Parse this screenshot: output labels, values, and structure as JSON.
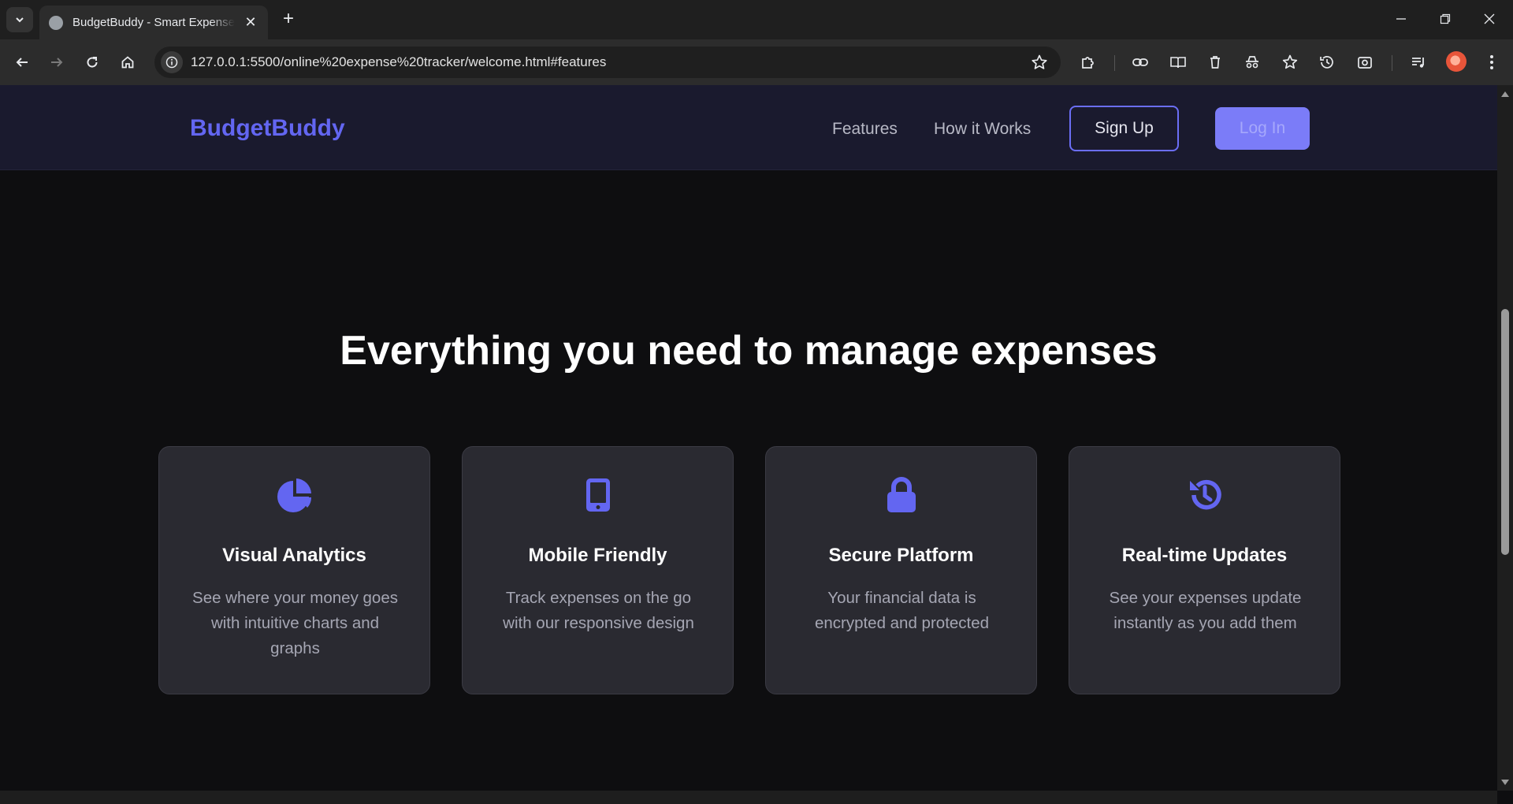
{
  "browser": {
    "tab_title": "BudgetBuddy - Smart Expense Tracker",
    "url": "127.0.0.1:5500/online%20expense%20tracker/welcome.html#features"
  },
  "site": {
    "brand": "BudgetBuddy",
    "nav": {
      "features": "Features",
      "how_it_works": "How it Works",
      "sign_up": "Sign Up",
      "log_in": "Log In"
    }
  },
  "features": {
    "title": "Everything you need to manage expenses",
    "cards": [
      {
        "icon": "pie-chart-icon",
        "title": "Visual Analytics",
        "description": "See where your money goes with intuitive charts and graphs"
      },
      {
        "icon": "mobile-icon",
        "title": "Mobile Friendly",
        "description": "Track expenses on the go with our responsive design"
      },
      {
        "icon": "lock-icon",
        "title": "Secure Platform",
        "description": "Your financial data is encrypted and protected"
      },
      {
        "icon": "history-icon",
        "title": "Real-time Updates",
        "description": "See your expenses update instantly as you add them"
      }
    ]
  },
  "colors": {
    "accent": "#6366f1",
    "nav_background": "#1a1a2e",
    "page_background": "#0e0e10",
    "card_background": "#2a2a31"
  }
}
